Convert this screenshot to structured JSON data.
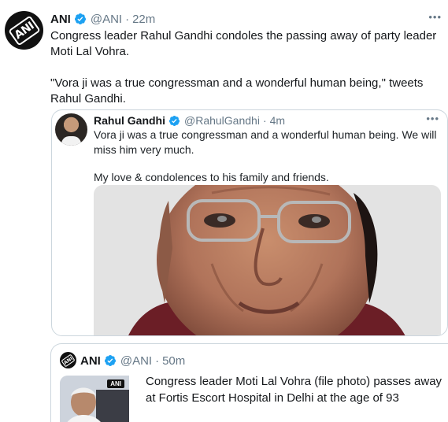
{
  "tweet": {
    "author_name": "ANI",
    "author_handle": "@ANI",
    "separator": "·",
    "time": "22m",
    "more": "•••",
    "paragraphs": [
      "Congress leader Rahul Gandhi condoles the passing away of party leader Moti Lal Vohra.",
      "\"Vora ji was a true congressman and a wonderful human being,\" tweets Rahul Gandhi."
    ],
    "avatar_logo": "ANI"
  },
  "quoted_tweet": {
    "author_name": "Rahul Gandhi",
    "author_handle": "@RahulGandhi",
    "separator": "·",
    "time": "4m",
    "more": "•••",
    "paragraphs": [
      "Vora ji was a true congressman and a wonderful human being. We will miss him very much.",
      "My love & condolences to his family and friends."
    ]
  },
  "linked_card": {
    "author_name": "ANI",
    "author_handle": "@ANI",
    "separator": "·",
    "time": "50m",
    "avatar_logo": "ANI",
    "thumb_tag": "ANI",
    "text": "Congress leader Moti Lal Vohra (file photo) passes away at Fortis Escort Hospital in Delhi at the age of 93"
  },
  "colors": {
    "verified": "#1da1f2",
    "secondary_text": "#657786",
    "border": "#ccd6dd"
  }
}
